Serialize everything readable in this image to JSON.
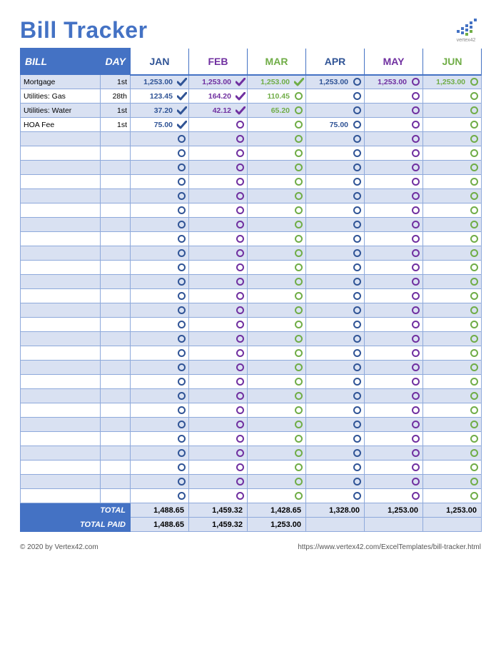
{
  "title": "Bill Tracker",
  "brand": "vertex42",
  "headers": {
    "bill": "BILL",
    "day": "DAY"
  },
  "months": [
    {
      "label": "JAN",
      "color": "#305496"
    },
    {
      "label": "FEB",
      "color": "#7030A0"
    },
    {
      "label": "MAR",
      "color": "#70AD47"
    },
    {
      "label": "APR",
      "color": "#305496"
    },
    {
      "label": "MAY",
      "color": "#7030A0"
    },
    {
      "label": "JUN",
      "color": "#70AD47"
    }
  ],
  "rows": [
    {
      "name": "Mortgage",
      "day": "1st",
      "vals": [
        "1,253.00",
        "1,253.00",
        "1,253.00",
        "1,253.00",
        "1,253.00",
        "1,253.00"
      ],
      "paid": [
        true,
        true,
        true,
        false,
        false,
        false
      ]
    },
    {
      "name": "Utilities: Gas",
      "day": "28th",
      "vals": [
        "123.45",
        "164.20",
        "110.45",
        "",
        "",
        ""
      ],
      "paid": [
        true,
        true,
        false,
        false,
        false,
        false
      ]
    },
    {
      "name": "Utilities: Water",
      "day": "1st",
      "vals": [
        "37.20",
        "42.12",
        "65.20",
        "",
        "",
        ""
      ],
      "paid": [
        true,
        true,
        false,
        false,
        false,
        false
      ]
    },
    {
      "name": "HOA Fee",
      "day": "1st",
      "vals": [
        "75.00",
        "",
        "",
        "75.00",
        "",
        ""
      ],
      "paid": [
        true,
        false,
        false,
        false,
        false,
        false
      ]
    }
  ],
  "emptyRows": 26,
  "totals": {
    "totalLabel": "TOTAL",
    "totalPaidLabel": "TOTAL PAID",
    "total": [
      "1,488.65",
      "1,459.32",
      "1,428.65",
      "1,328.00",
      "1,253.00",
      "1,253.00"
    ],
    "totalPaid": [
      "1,488.65",
      "1,459.32",
      "1,253.00",
      "",
      "",
      ""
    ]
  },
  "footer": {
    "left": "© 2020 by Vertex42.com",
    "right": "https://www.vertex42.com/ExcelTemplates/bill-tracker.html"
  }
}
